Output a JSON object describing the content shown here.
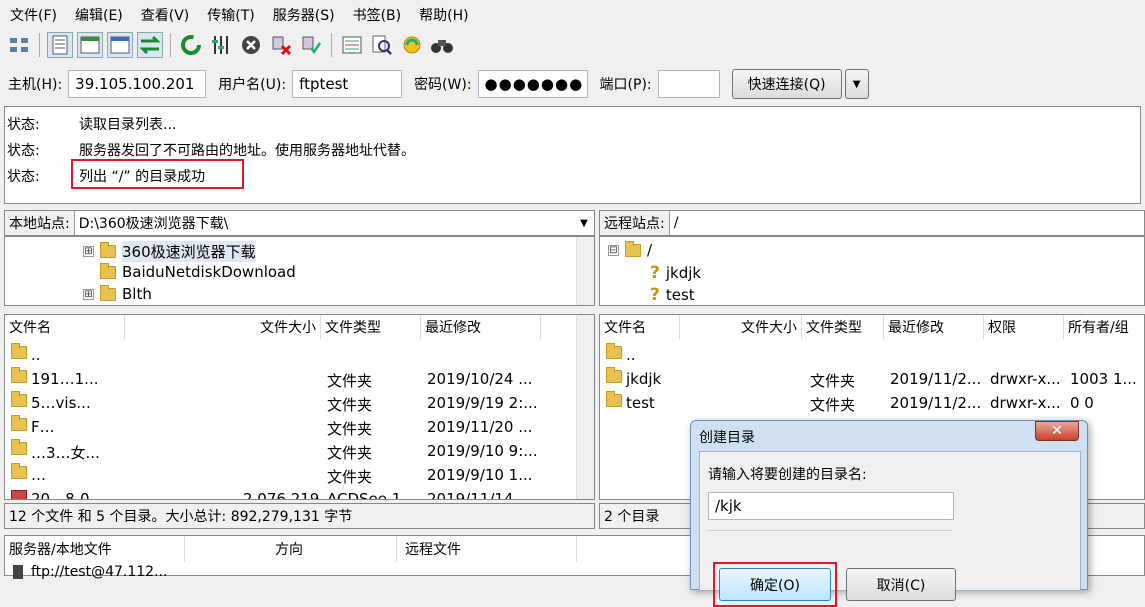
{
  "menubar": {
    "items": [
      "文件(F)",
      "编辑(E)",
      "查看(V)",
      "传输(T)",
      "服务器(S)",
      "书签(B)",
      "帮助(H)"
    ]
  },
  "toolbar": {
    "icons": [
      "site-manager-icon",
      "message-log-icon",
      "local-tree-icon",
      "remote-tree-icon",
      "transfer-queue-icon",
      "refresh-icon",
      "filter-icon",
      "cancel-icon",
      "disconnect-icon",
      "reconnect-icon",
      "directory-compare-icon",
      "search-icon",
      "sync-browse-icon",
      "find-binoculars-icon"
    ]
  },
  "connection": {
    "host_label": "主机(H):",
    "host": "39.105.100.201",
    "user_label": "用户名(U):",
    "user": "ftptest",
    "pass_label": "密码(W):",
    "pass": "●●●●●●●",
    "port_label": "端口(P):",
    "port": "",
    "quickconnect": "快速连接(Q)",
    "dropdown": "▼"
  },
  "log": {
    "rows": [
      {
        "tag": "状态:",
        "msg": "读取目录列表..."
      },
      {
        "tag": "状态:",
        "msg": "服务器发回了不可路由的地址。使用服务器地址代替。"
      },
      {
        "tag": "状态:",
        "msg": "列出 “/” 的目录成功"
      }
    ]
  },
  "local": {
    "site_label": "本地站点:",
    "path": "D:\\360极速浏览器下载\\",
    "tree": [
      {
        "name": "360极速浏览器下载",
        "expander": "⊞"
      },
      {
        "name": "BaiduNetdiskDownload",
        "expander": ""
      },
      {
        "name": "Blth",
        "expander": "⊞"
      }
    ],
    "columns": [
      "文件名",
      "文件大小",
      "文件类型",
      "最近修改"
    ],
    "rows": [
      {
        "name": "..",
        "size": "",
        "type": "",
        "modified": ""
      },
      {
        "name": "191…1...",
        "size": "",
        "type": "文件夹",
        "modified": "2019/10/24 ..."
      },
      {
        "name": "5…vis...",
        "size": "",
        "type": "文件夹",
        "modified": "2019/9/19 2:..."
      },
      {
        "name": "F…",
        "size": "",
        "type": "文件夹",
        "modified": "2019/11/20 ..."
      },
      {
        "name": "…3…女...",
        "size": "",
        "type": "文件夹",
        "modified": "2019/9/10 9:..."
      },
      {
        "name": "…",
        "size": "",
        "type": "文件夹",
        "modified": "2019/9/10 1..."
      },
      {
        "name": "20…8-0",
        "size": "2,076,219",
        "type": "ACDSee 1...",
        "modified": "2019/11/14 ..."
      }
    ],
    "status": "12 个文件 和 5 个目录。大小总计: 892,279,131 字节"
  },
  "remote": {
    "site_label": "远程站点:",
    "path": "/",
    "tree": [
      {
        "name": "/",
        "expander": "⊟"
      },
      {
        "name": "jkdjk",
        "expander": ""
      },
      {
        "name": "test",
        "expander": ""
      }
    ],
    "columns": [
      "文件名",
      "文件大小",
      "文件类型",
      "最近修改",
      "权限",
      "所有者/组"
    ],
    "rows": [
      {
        "name": "..",
        "size": "",
        "type": "",
        "modified": "",
        "perm": "",
        "owner": ""
      },
      {
        "name": "jkdjk",
        "size": "",
        "type": "文件夹",
        "modified": "2019/11/2...",
        "perm": "drwxr-x...",
        "owner": "1003 1..."
      },
      {
        "name": "test",
        "size": "",
        "type": "文件夹",
        "modified": "2019/11/2...",
        "perm": "drwxr-x...",
        "owner": "0 0"
      }
    ],
    "status": "2 个目录"
  },
  "queue": {
    "columns": [
      "服务器/本地文件",
      "方向",
      "远程文件"
    ],
    "first_row": "ftp://test@47.112..."
  },
  "dialog": {
    "title": "创建目录",
    "close": "✕",
    "prompt": "请输入将要创建的目录名:",
    "value": "/kjk",
    "ok": "确定(O)",
    "cancel": "取消(C)"
  }
}
